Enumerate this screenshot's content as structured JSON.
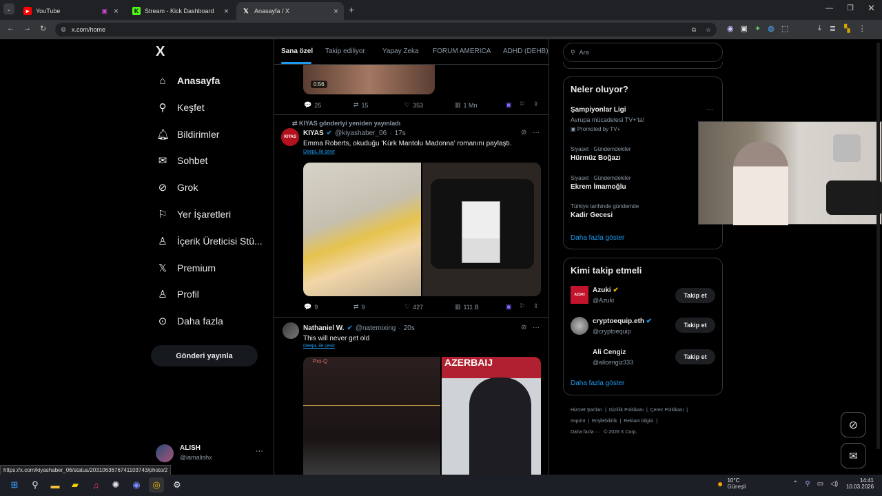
{
  "browser": {
    "tabs": [
      {
        "title": "YouTube"
      },
      {
        "title": "Stream - Kick Dashboard"
      },
      {
        "title": "Anasayfa / X"
      }
    ],
    "url": "x.com/home",
    "status_url": "https://x.com/kiyashaber_06/status/2031063676741103743/photo/2"
  },
  "nav": {
    "logo": "X",
    "items": [
      {
        "label": "Anasayfa",
        "icon": "home-icon"
      },
      {
        "label": "Keşfet",
        "icon": "search-icon"
      },
      {
        "label": "Bildirimler",
        "icon": "bell-icon"
      },
      {
        "label": "Sohbet",
        "icon": "mail-icon"
      },
      {
        "label": "Grok",
        "icon": "grok-icon"
      },
      {
        "label": "Yer İşaretleri",
        "icon": "bookmark-icon"
      },
      {
        "label": "İçerik Üreticisi Stü...",
        "icon": "creator-icon"
      },
      {
        "label": "Premium",
        "icon": "x-icon"
      },
      {
        "label": "Profil",
        "icon": "person-icon"
      },
      {
        "label": "Daha fazla",
        "icon": "more-circle-icon"
      }
    ],
    "post_button": "Gönderi yayınla",
    "user": {
      "name": "ALISH",
      "handle": "@iamalishx"
    }
  },
  "feed": {
    "tabs": [
      "Sana özel",
      "Takip ediliyor",
      "Yapay Zeka",
      "FORUM AMERICA",
      "ADHD (DEHB)"
    ],
    "top_post": {
      "duration": "0:56",
      "replies": "25",
      "reposts": "15",
      "likes": "353",
      "views": "1 Mn"
    },
    "post1": {
      "repost_note": "KIYAS gönderiyi yeniden yayınladı",
      "avatar": "KIYAS",
      "name": "KIYAS",
      "handle": "@kiyashaber_06",
      "time": "17s",
      "text": "Emma Roberts, okuduğu 'Kürk Mantolu Madonna' romanını paylaştı.",
      "translate": "DeepL ile çevir",
      "replies": "9",
      "reposts": "9",
      "likes": "427",
      "views": "111 B"
    },
    "post2": {
      "name": "Nathaniel W.",
      "handle": "@natemixing",
      "time": "20s",
      "text": "This will never get old",
      "translate": "DeepL ile çevir",
      "img_label": "AZERBAIJ",
      "eq_label": "Pro-Q"
    }
  },
  "sidebar": {
    "search_placeholder": "Ara",
    "trends_title": "Neler oluyor?",
    "trends": [
      {
        "name": "Şampiyonlar Ligi",
        "meta": "Avrupa mücadelesi TV+'ta!",
        "promo": "Promoted by TV+"
      },
      {
        "meta": "Siyaset · Gündemdekiler",
        "name": "Hürmüz Boğazı"
      },
      {
        "meta": "Siyaset · Gündemdekiler",
        "name": "Ekrem İmamoğlu"
      },
      {
        "meta": "Türkiye tarihinde gündemde",
        "name": "Kadir Gecesi"
      }
    ],
    "show_more": "Daha fazla göster",
    "follow_title": "Kimi takip etmeli",
    "follow": [
      {
        "name": "Azuki",
        "handle": "@Azuki",
        "avatar": "AZUKI"
      },
      {
        "name": "cryptoequip.eth",
        "handle": "@cryptoequip"
      },
      {
        "name": "Ali Cengiz",
        "handle": "@alicengiz333"
      }
    ],
    "follow_btn": "Takip et",
    "show_more2": "Daha fazla göster",
    "footer": [
      "Hizmet Şartları",
      "Gizlilik Politikası",
      "Çerez Politikası",
      "Imprint",
      "Erişilebilirlik",
      "Reklam bilgisi",
      "Daha fazla ···",
      "© 2026 X Corp."
    ]
  },
  "taskbar": {
    "weather_temp": "10°C",
    "weather_desc": "Güneşli",
    "time": "14:41",
    "date": "10.03.2026"
  },
  "colors": {
    "accent": "#1d9bf0",
    "bg": "#000000",
    "border": "#2f3336"
  }
}
